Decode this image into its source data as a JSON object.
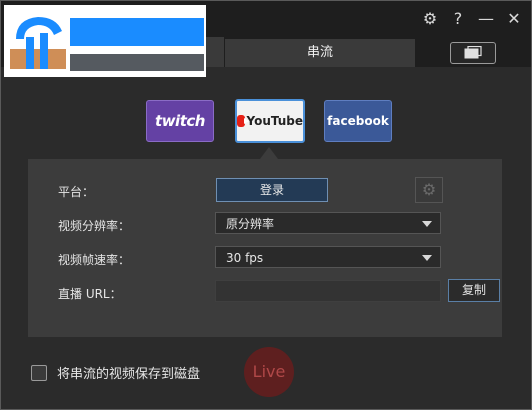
{
  "window": {
    "icons": [
      "gear-icon",
      "help-icon",
      "minimize-icon",
      "close-icon"
    ],
    "gear_glyph": "⚙",
    "help_glyph": "?",
    "minimize_glyph": "—",
    "close_glyph": "✕"
  },
  "tabs": {
    "active_label": "串流"
  },
  "platforms": [
    {
      "name": "twitch",
      "label": "twitch",
      "color": "#6441a4"
    },
    {
      "name": "youtube",
      "label": "YouTube",
      "color": "#e62117",
      "selected": true
    },
    {
      "name": "facebook",
      "label": "facebook",
      "color": "#3b5998"
    }
  ],
  "form": {
    "platform_label": "平台：",
    "login_label": "登录",
    "resolution_label": "视频分辨率：",
    "resolution_value": "原分辨率",
    "framerate_label": "视频帧速率：",
    "framerate_value": "30 fps",
    "url_label": "直播 URL：",
    "url_value": "",
    "copy_label": "复制"
  },
  "footer": {
    "save_label": "将串流的视频保存到磁盘",
    "save_checked": false,
    "live_label": "Live"
  },
  "colors": {
    "background": "#2b2b2b",
    "panel": "#3c3c3c",
    "accent": "#4a90d9",
    "live": "#5e1f1f"
  }
}
